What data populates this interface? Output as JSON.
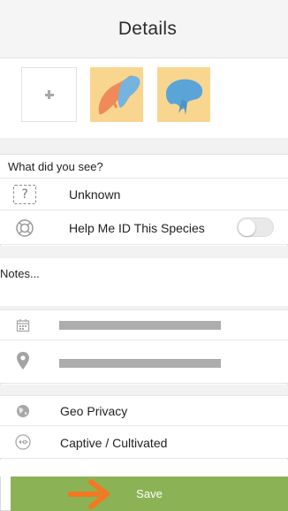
{
  "header": {
    "title": "Details"
  },
  "photos": {
    "add_icon": "plus-icon",
    "thumbnails": [
      "photo-thumbnail-1",
      "photo-thumbnail-2"
    ]
  },
  "identification": {
    "section_title": "What did you see?",
    "species_value": "Unknown",
    "species_icon": "unknown-species-icon",
    "help_label": "Help Me ID This Species",
    "help_icon": "lifebuoy-icon",
    "help_toggle_on": false
  },
  "notes": {
    "placeholder": "Notes..."
  },
  "meta": {
    "date_icon": "calendar-icon",
    "location_icon": "map-pin-icon"
  },
  "options": {
    "geo_privacy_label": "Geo Privacy",
    "geo_privacy_icon": "globe-icon",
    "captive_label": "Captive / Cultivated",
    "captive_icon": "captive-icon"
  },
  "footer": {
    "save_label": "Save",
    "accent_color": "#8bb356",
    "arrow_color": "#f47820"
  }
}
